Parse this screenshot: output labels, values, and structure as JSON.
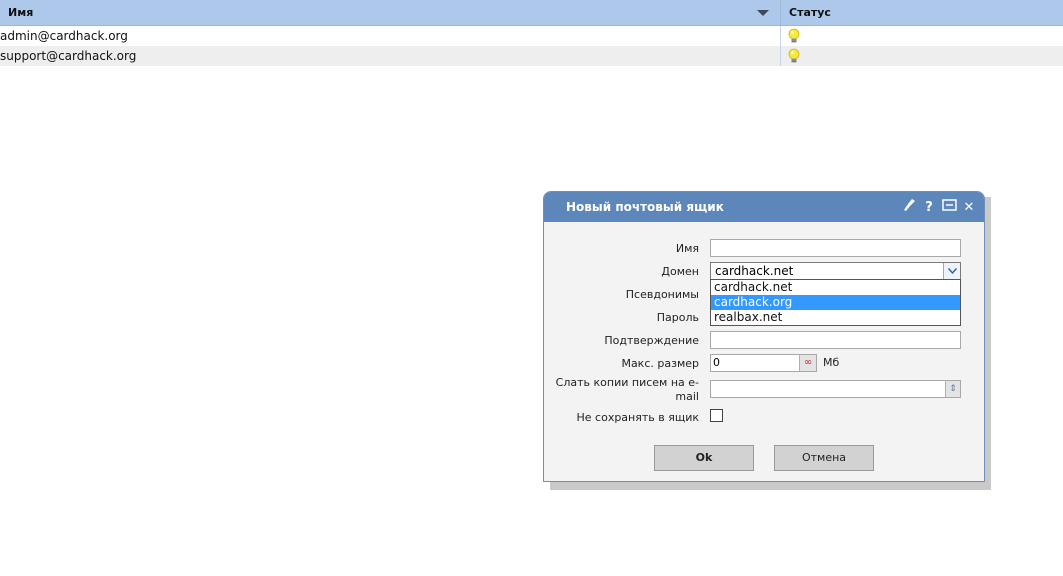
{
  "table": {
    "headers": {
      "name": "Имя",
      "status": "Статус"
    },
    "rows": [
      {
        "name": "admin@cardhack.org",
        "status_icon": "lightbulb-icon"
      },
      {
        "name": "support@cardhack.org",
        "status_icon": "lightbulb-icon"
      }
    ]
  },
  "dialog": {
    "title": "Новый почтовый ящик",
    "toolbar_icons": [
      "broom-icon",
      "help-icon",
      "resize-icon",
      "close-icon"
    ],
    "help_glyph": "?",
    "close_glyph": "✕",
    "fields": {
      "name_label": "Имя",
      "name_value": "",
      "domain_label": "Домен",
      "domain_value": "cardhack.net",
      "aliases_label": "Псевдонимы",
      "password_label": "Пароль",
      "confirm_label": "Подтверждение",
      "max_size_label": "Макс. размер",
      "max_size_value": "0",
      "max_size_unit": "Мб",
      "unlimited_glyph": "∞",
      "copies_label": "Слать копии писем на e-mail",
      "copies_value": "",
      "no_save_label": "Не сохранять в ящик"
    },
    "domain_options": [
      {
        "label": "cardhack.net",
        "selected": false
      },
      {
        "label": "cardhack.org",
        "selected": true
      },
      {
        "label": "realbax.net",
        "selected": false
      }
    ],
    "buttons": {
      "ok": "Ok",
      "cancel": "Отмена"
    }
  },
  "colors": {
    "header_bg": "#aec8ec",
    "titlebar_bg": "#5d86bb",
    "option_highlight": "#3399ff"
  }
}
